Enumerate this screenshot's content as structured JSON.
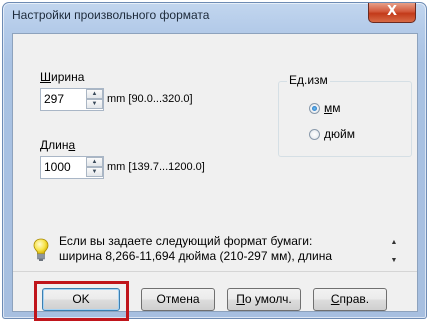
{
  "window": {
    "title": "Настройки произвольного формата",
    "close_label": "X"
  },
  "width": {
    "label_first": "Ш",
    "label_rest": "ирина",
    "value": "297",
    "range": "mm [90.0...320.0]"
  },
  "length": {
    "label_first": "Длин",
    "label_underlined": "а",
    "value": "1000",
    "range": "mm [139.7...1200.0]"
  },
  "units": {
    "title": "Ед.изм",
    "options": [
      {
        "label_first": "м",
        "label_rest": "м",
        "checked": true
      },
      {
        "label_first": "д",
        "label_rest": "юйм",
        "checked": false
      }
    ]
  },
  "info": {
    "line1": "Если вы задаете следующий формат бумаги:",
    "line2": "ширина 8,266-11,694 дюйма (210-297 мм), длина"
  },
  "buttons": {
    "ok": "OK",
    "cancel": "Отмена",
    "default_first": "П",
    "default_rest": "о умолч.",
    "help_first": "С",
    "help_rest": "прав."
  },
  "colors": {
    "highlight": "#c0151b",
    "title_bar": "#b4cbe9"
  },
  "icons": {
    "info": "lightbulb-icon",
    "spin_up": "arrow-up-icon",
    "spin_down": "arrow-down-icon"
  }
}
